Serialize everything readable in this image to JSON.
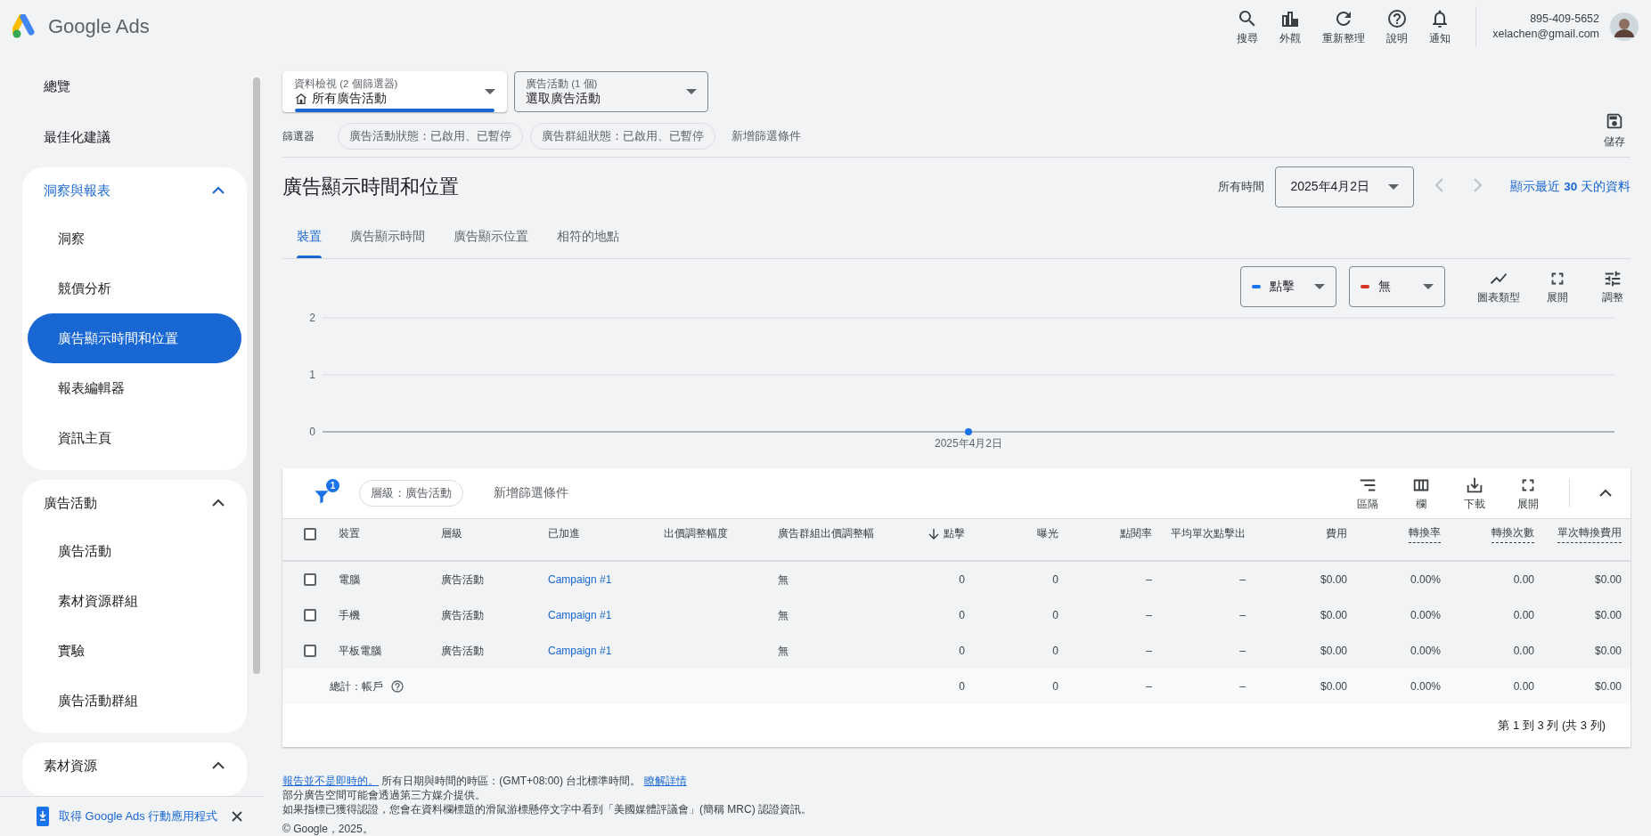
{
  "app": {
    "name": "Google Ads"
  },
  "header": {
    "actions": [
      {
        "kind": "search",
        "label": "搜尋"
      },
      {
        "kind": "appearance",
        "label": "外觀"
      },
      {
        "kind": "refresh",
        "label": "重新整理"
      },
      {
        "kind": "help",
        "label": "說明"
      },
      {
        "kind": "notifications",
        "label": "通知"
      }
    ],
    "account": {
      "phone": "895-409-5652",
      "email": "xelachen@gmail.com"
    }
  },
  "sidebar": {
    "items": [
      {
        "kind": "item",
        "label": "總覽",
        "selected": false
      },
      {
        "kind": "item",
        "label": "最佳化建議",
        "selected": false
      },
      {
        "kind": "group",
        "label": "洞察與報表",
        "expanded": true,
        "active": true,
        "children": [
          {
            "label": "洞察",
            "selected": false
          },
          {
            "label": "競價分析",
            "selected": false
          },
          {
            "label": "廣告顯示時間和位置",
            "selected": true
          },
          {
            "label": "報表編輯器",
            "selected": false
          },
          {
            "label": "資訊主頁",
            "selected": false
          }
        ]
      },
      {
        "kind": "group",
        "label": "廣告活動",
        "expanded": true,
        "active": false,
        "children": [
          {
            "label": "廣告活動",
            "selected": false
          },
          {
            "label": "素材資源群組",
            "selected": false
          },
          {
            "label": "實驗",
            "selected": false
          },
          {
            "label": "廣告活動群組",
            "selected": false
          }
        ]
      },
      {
        "kind": "group",
        "label": "素材資源",
        "expanded": true,
        "active": false
      }
    ],
    "promo": {
      "text": "取得 Google Ads 行動應用程式"
    }
  },
  "views": [
    {
      "kind": "home",
      "label": "資料檢視 (2 個篩選器)",
      "value": "所有廣告活動",
      "selected": true
    },
    {
      "kind": "plain",
      "label": "廣告活動 (1 個)",
      "value": "選取廣告活動",
      "selected": false
    }
  ],
  "filters": {
    "label": "篩選器",
    "chips": [
      "廣告活動狀態：已啟用、已暫停",
      "廣告群組狀態：已啟用、已暫停"
    ],
    "add": "新增篩選條件"
  },
  "save": {
    "label": "儲存"
  },
  "page": {
    "title": "廣告顯示時間和位置",
    "range_label": "所有時間",
    "date": "2025年4月2日",
    "prev_disabled": true,
    "next_disabled": true,
    "recent_link": "顯示最近 **30** 天的資料"
  },
  "tabs": [
    {
      "label": "裝置",
      "selected": true
    },
    {
      "label": "廣告顯示時間",
      "selected": false
    },
    {
      "label": "廣告顯示位置",
      "selected": false
    },
    {
      "label": "相符的地點",
      "selected": false
    }
  ],
  "chart": {
    "metrics": [
      {
        "label": "點擊",
        "color": "#1a73e8"
      },
      {
        "label": "無",
        "color": "#d93025"
      }
    ],
    "tools": [
      {
        "kind": "chart_type",
        "label": "圖表類型"
      },
      {
        "kind": "expand",
        "label": "展開"
      },
      {
        "kind": "adjust",
        "label": "調整"
      }
    ],
    "chart_data": {
      "type": "line",
      "x": [
        "2025年4月2日"
      ],
      "series": [
        {
          "color": "#1a73e8",
          "marker": "circle",
          "values": [
            0
          ]
        }
      ],
      "ylim": [
        0,
        2
      ],
      "yticks": [
        0,
        1,
        2
      ]
    }
  },
  "table": {
    "toolbar": {
      "filter_count": "1",
      "chips": [
        "層級：廣告活動"
      ],
      "add": "新增篩選條件",
      "tools": [
        {
          "kind": "segment",
          "label": "區隔"
        },
        {
          "kind": "columns",
          "label": "欄"
        },
        {
          "kind": "download",
          "label": "下載"
        },
        {
          "kind": "expand",
          "label": "展開"
        }
      ]
    },
    "all_checked": false,
    "columns": [
      {
        "label": "裝置",
        "kind": "text"
      },
      {
        "label": "層級",
        "kind": "text"
      },
      {
        "label": "已加進",
        "kind": "link"
      },
      {
        "label": "出價調整幅度",
        "kind": "text"
      },
      {
        "label": "廣告群組出價調整幅",
        "kind": "text"
      },
      {
        "label": "點擊",
        "kind": "metric",
        "sorted": true
      },
      {
        "label": "曝光",
        "kind": "metric"
      },
      {
        "label": "點閱率",
        "kind": "metric"
      },
      {
        "label": "平均單次點擊出",
        "kind": "metric"
      },
      {
        "label": "費用",
        "kind": "metric"
      },
      {
        "label": "轉換率",
        "kind": "metric",
        "underlined": true
      },
      {
        "label": "轉換次數",
        "kind": "metric",
        "underlined": true
      },
      {
        "label": "單次轉換費用",
        "kind": "metric",
        "underlined": true
      }
    ],
    "rows": [
      {
        "checked": false,
        "cells": [
          "電腦",
          "廣告活動",
          "Campaign #1",
          null,
          "無",
          "0",
          "0",
          "–",
          "–",
          "$0.00",
          "0.00%",
          "0.00",
          "$0.00"
        ]
      },
      {
        "checked": false,
        "cells": [
          "手機",
          "廣告活動",
          "Campaign #1",
          null,
          "無",
          "0",
          "0",
          "–",
          "–",
          "$0.00",
          "0.00%",
          "0.00",
          "$0.00"
        ]
      },
      {
        "checked": false,
        "cells": [
          "平板電腦",
          "廣告活動",
          "Campaign #1",
          null,
          "無",
          "0",
          "0",
          "–",
          "–",
          "$0.00",
          "0.00%",
          "0.00",
          "$0.00"
        ]
      }
    ],
    "total": {
      "label": "總計：帳戶",
      "cells": [
        null,
        null,
        null,
        null,
        null,
        "0",
        "0",
        "–",
        "–",
        "$0.00",
        "0.00%",
        "0.00",
        "$0.00"
      ]
    },
    "pagination": "第 1 到 3 列 (共 3 列)"
  },
  "footer": {
    "line1": {
      "link": "報告並不是即時的。",
      "text": "所有日期與時間的時區：(GMT+08:00) 台北標準時間。",
      "more": "瞭解詳情"
    },
    "lines": [
      "部分廣告空間可能會透過第三方媒介提供。",
      "如果指標已獲得認證，您會在資料欄標題的滑鼠游標懸停文字中看到「美國媒體評議會」(簡稱 MRC) 認證資訊。",
      "© Google，2025。"
    ]
  }
}
